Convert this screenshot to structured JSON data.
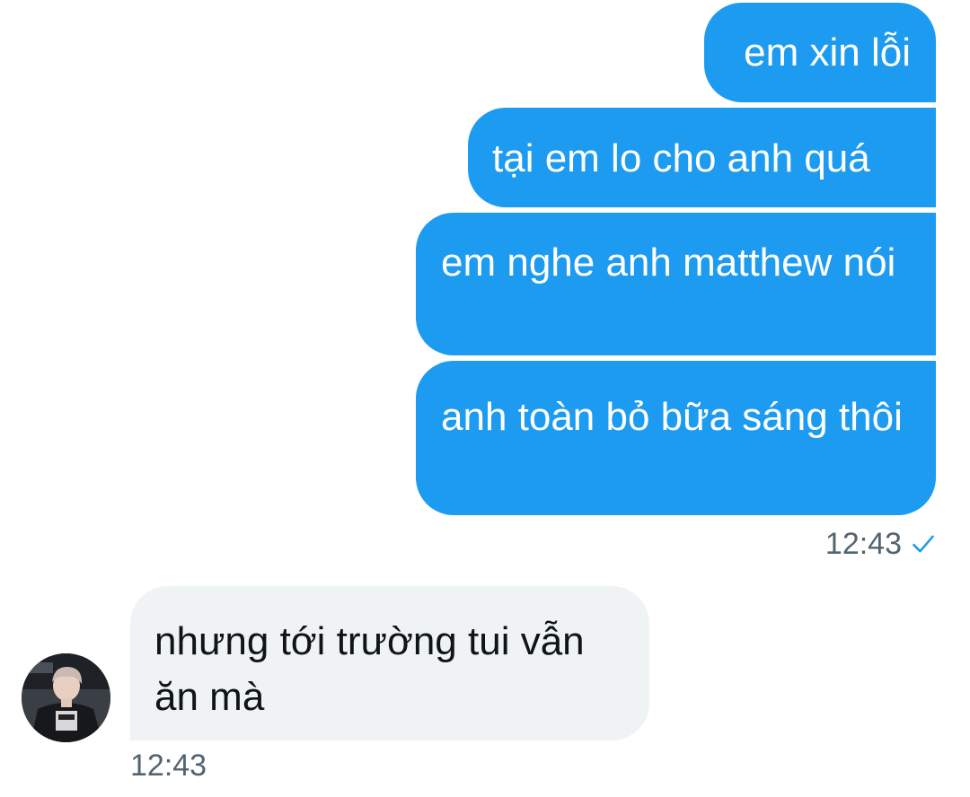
{
  "messages": [
    {
      "direction": "outgoing",
      "text": "em xin lỗi"
    },
    {
      "direction": "outgoing",
      "text": "tại em lo cho anh quá"
    },
    {
      "direction": "outgoing",
      "text": "em nghe anh matthew nói"
    },
    {
      "direction": "outgoing",
      "text": "anh toàn bỏ bữa sáng thôi"
    },
    {
      "direction": "incoming",
      "text": "nhưng tới trường tui vẫn ăn mà"
    }
  ],
  "outgoing_time": "12:43",
  "incoming_time": "12:43",
  "colors": {
    "outgoing_bubble": "#1d9bf0",
    "incoming_bubble": "#eff3f4",
    "timestamp": "#536471",
    "read_check": "#1d9bf0"
  },
  "icons": {
    "read_receipt": "check-icon"
  }
}
